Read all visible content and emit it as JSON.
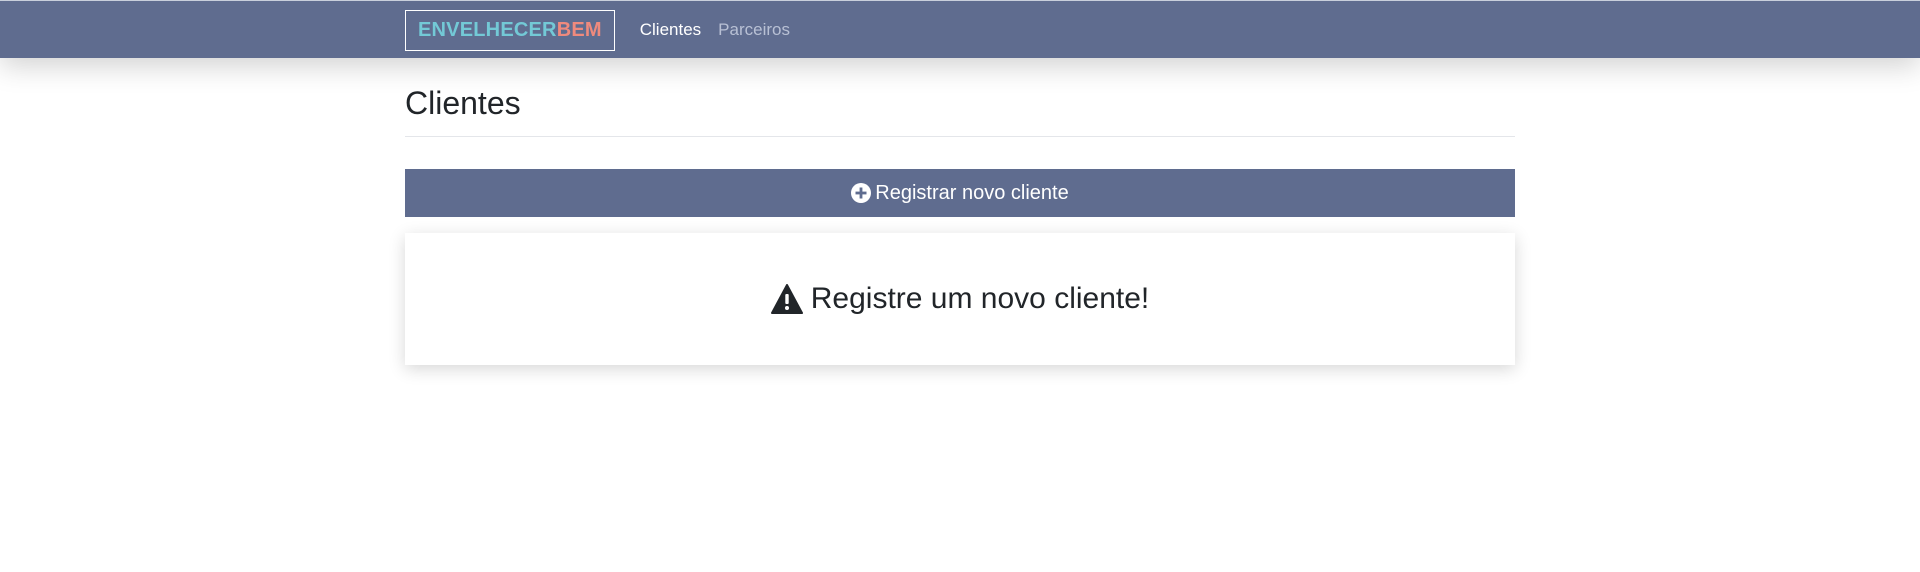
{
  "navbar": {
    "brand_part1": "ENVELHECER",
    "brand_part2": "BEM",
    "links": [
      {
        "label": "Clientes",
        "active": true
      },
      {
        "label": "Parceiros",
        "active": false
      }
    ],
    "brand_color_1": "#73c9d6",
    "brand_color_2": "#ef8a7d",
    "background": "#5f6c8f"
  },
  "main": {
    "title": "Clientes",
    "register_button": {
      "label": "Registrar novo cliente",
      "icon": "plus-circle-icon"
    },
    "empty_state": {
      "message": "Registre um novo cliente!",
      "icon": "warning-triangle-icon"
    }
  }
}
